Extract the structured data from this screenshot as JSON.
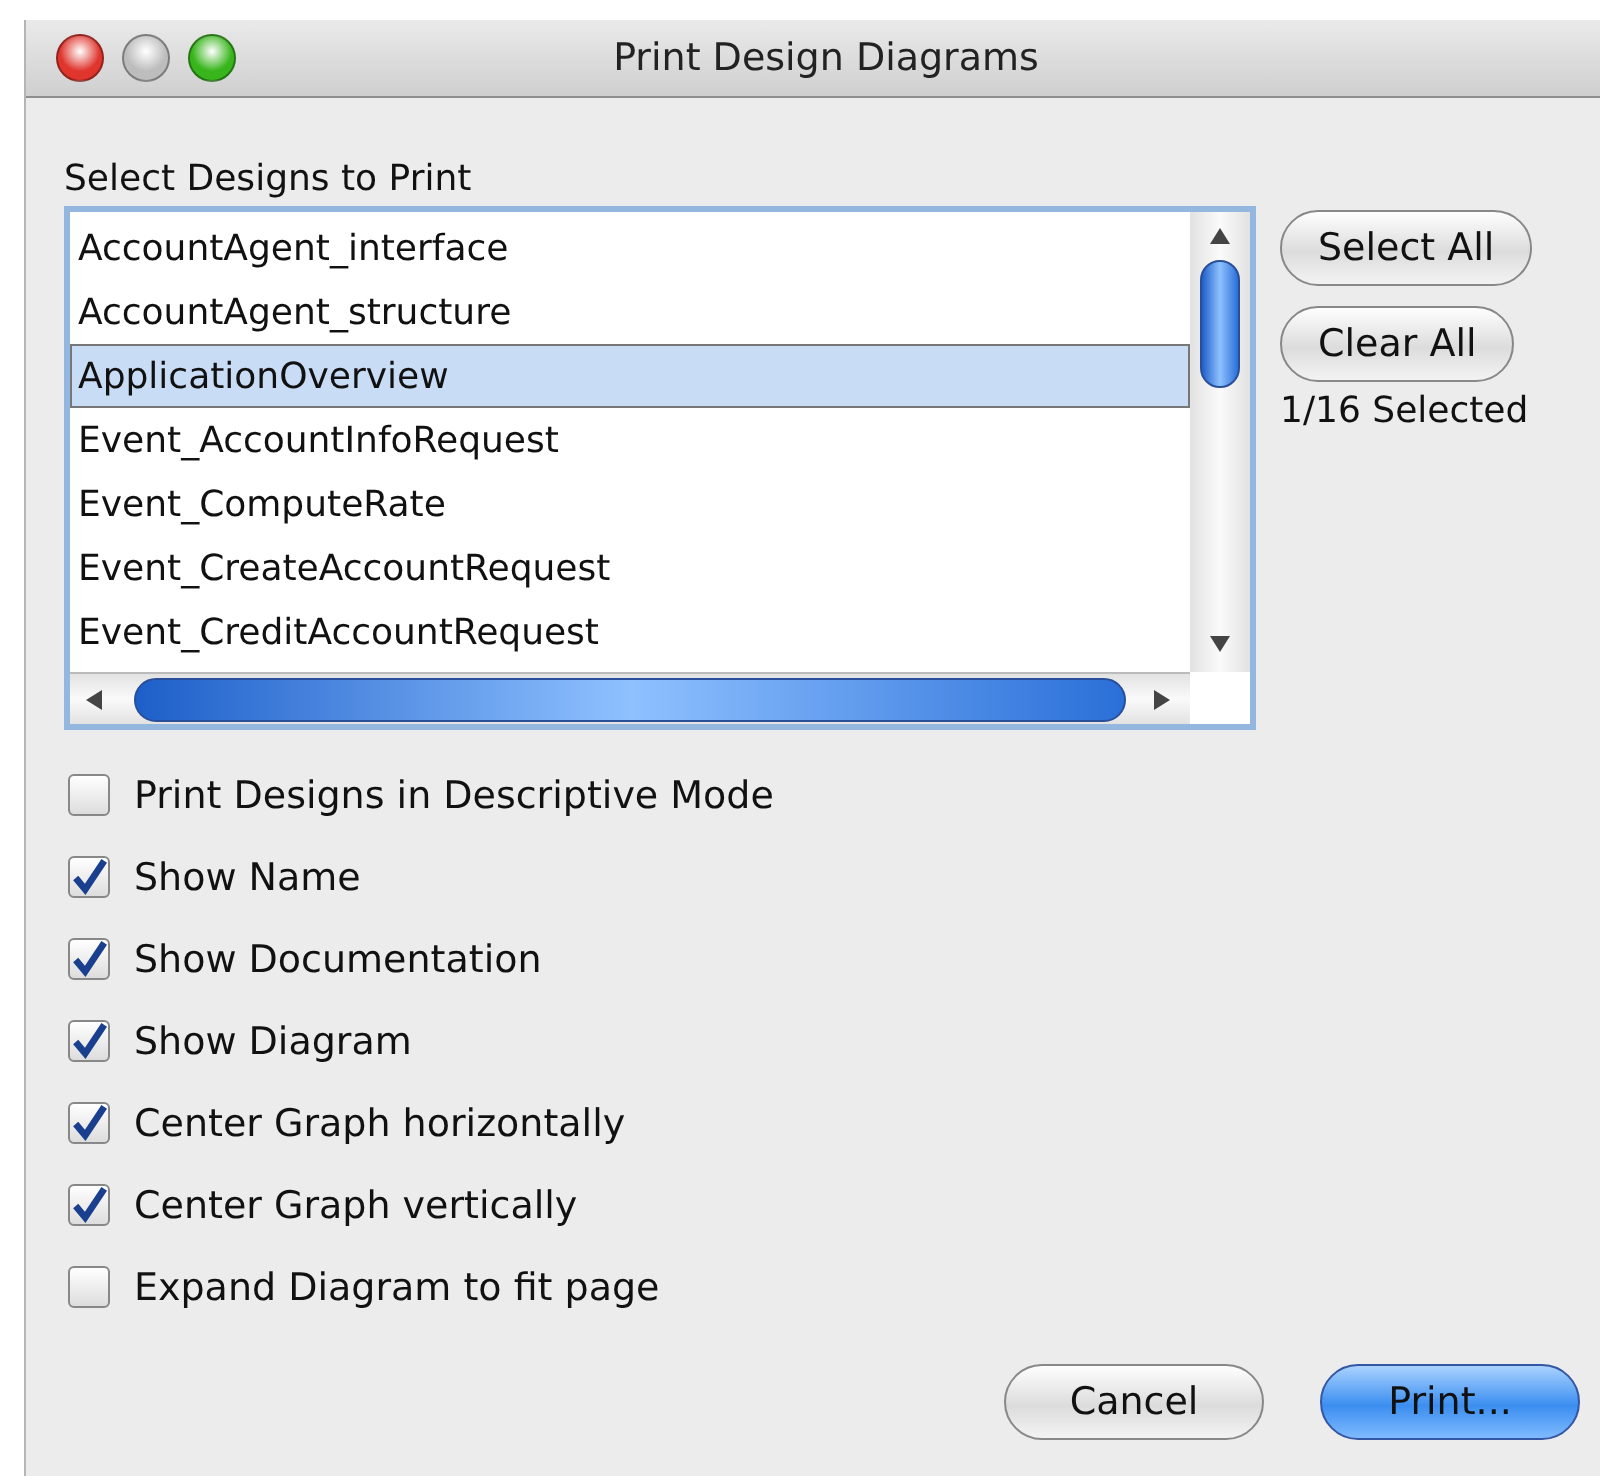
{
  "window": {
    "title": "Print Design Diagrams"
  },
  "list": {
    "label": "Select Designs to Print",
    "items": [
      {
        "label": "AccountAgent_interface",
        "selected": false
      },
      {
        "label": "AccountAgent_structure",
        "selected": false
      },
      {
        "label": "ApplicationOverview",
        "selected": true
      },
      {
        "label": "Event_AccountInfoRequest",
        "selected": false
      },
      {
        "label": "Event_ComputeRate",
        "selected": false
      },
      {
        "label": "Event_CreateAccountRequest",
        "selected": false
      },
      {
        "label": "Event_CreditAccountRequest",
        "selected": false
      }
    ]
  },
  "side_buttons": [
    "Select All",
    "Clear All"
  ],
  "selection_count": "1/16 Selected",
  "options": [
    {
      "label": "Print Designs in Descriptive Mode",
      "checked": false
    },
    {
      "label": "Show Name",
      "checked": true
    },
    {
      "label": "Show Documentation",
      "checked": true
    },
    {
      "label": "Show Diagram",
      "checked": true
    },
    {
      "label": "Center Graph horizontally",
      "checked": true
    },
    {
      "label": "Center Graph vertically",
      "checked": true
    },
    {
      "label": "Expand Diagram to fit page",
      "checked": false
    }
  ],
  "buttons": [
    {
      "label": "Cancel",
      "kind": "normal"
    },
    {
      "label": "Print...",
      "kind": "default"
    }
  ]
}
